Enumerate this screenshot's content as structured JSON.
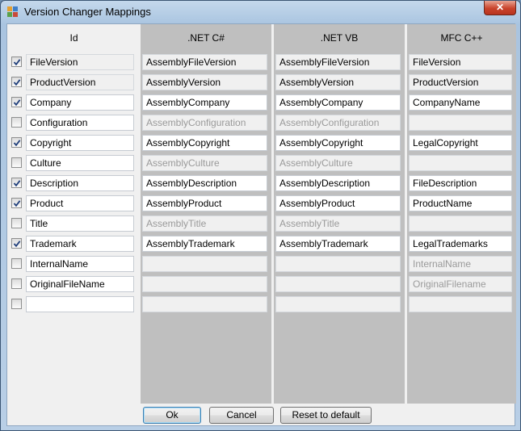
{
  "window": {
    "title": "Version Changer Mappings",
    "close_glyph": "✕"
  },
  "columns": [
    "Id",
    ".NET C#",
    ".NET VB",
    "MFC C++"
  ],
  "rows": [
    {
      "checked": true,
      "id": "FileVersion",
      "cs": "AssemblyFileVersion",
      "vb": "AssemblyFileVersion",
      "cpp": "FileVersion",
      "state": "ro"
    },
    {
      "checked": true,
      "id": "ProductVersion",
      "cs": "AssemblyVersion",
      "vb": "AssemblyVersion",
      "cpp": "ProductVersion",
      "state": "ro"
    },
    {
      "checked": true,
      "id": "Company",
      "cs": "AssemblyCompany",
      "vb": "AssemblyCompany",
      "cpp": "CompanyName",
      "state": "on"
    },
    {
      "checked": false,
      "id": "Configuration",
      "cs": "AssemblyConfiguration",
      "vb": "AssemblyConfiguration",
      "cpp": "",
      "state": "off"
    },
    {
      "checked": true,
      "id": "Copyright",
      "cs": "AssemblyCopyright",
      "vb": "AssemblyCopyright",
      "cpp": "LegalCopyright",
      "state": "on"
    },
    {
      "checked": false,
      "id": "Culture",
      "cs": "AssemblyCulture",
      "vb": "AssemblyCulture",
      "cpp": "",
      "state": "off"
    },
    {
      "checked": true,
      "id": "Description",
      "cs": "AssemblyDescription",
      "vb": "AssemblyDescription",
      "cpp": "FileDescription",
      "state": "on"
    },
    {
      "checked": true,
      "id": "Product",
      "cs": "AssemblyProduct",
      "vb": "AssemblyProduct",
      "cpp": "ProductName",
      "state": "on"
    },
    {
      "checked": false,
      "id": "Title",
      "cs": "AssemblyTitle",
      "vb": "AssemblyTitle",
      "cpp": "",
      "state": "off"
    },
    {
      "checked": true,
      "id": "Trademark",
      "cs": "AssemblyTrademark",
      "vb": "AssemblyTrademark",
      "cpp": "LegalTrademarks",
      "state": "on"
    },
    {
      "checked": false,
      "id": "InternalName",
      "cs": "",
      "vb": "",
      "cpp": "InternalName",
      "state": "off"
    },
    {
      "checked": false,
      "id": "OriginalFileName",
      "cs": "",
      "vb": "",
      "cpp": "OriginalFilename",
      "state": "off"
    },
    {
      "checked": false,
      "id": "",
      "cs": "",
      "vb": "",
      "cpp": "",
      "state": "off"
    }
  ],
  "buttons": {
    "ok": "Ok",
    "cancel": "Cancel",
    "reset": "Reset to default"
  },
  "colors": {
    "id_column": "#f0f0f0",
    "value_column": "#bfbfbf",
    "disabled_text": "#9a9a9a"
  }
}
